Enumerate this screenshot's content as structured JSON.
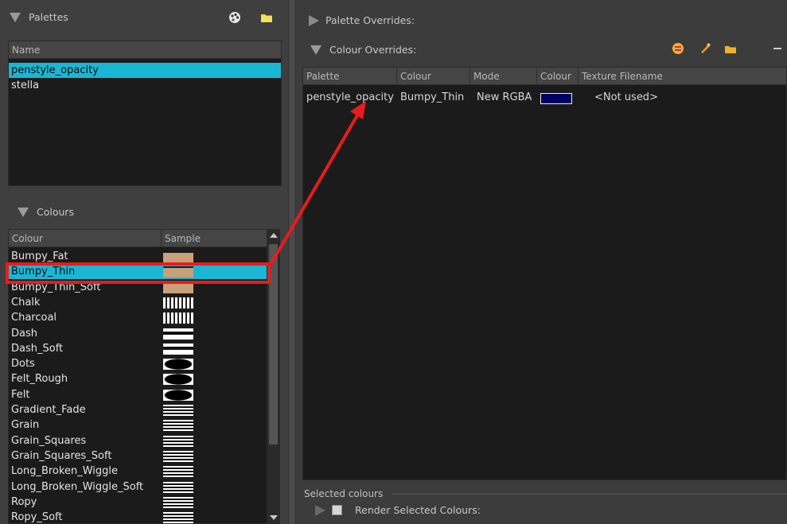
{
  "palettes_panel": {
    "title": "Palettes",
    "column_name": "Name",
    "items": [
      "penstyle_opacity",
      "stella"
    ],
    "selected_index": 0
  },
  "colours_panel": {
    "title": "Colours",
    "columns": [
      "Colour",
      "Sample"
    ],
    "items": [
      "Bumpy_Fat",
      "Bumpy_Thin",
      "Bumpy_Thin_Soft",
      "Chalk",
      "Charcoal",
      "Dash",
      "Dash_Soft",
      "Dots",
      "Felt_Rough",
      "Felt",
      "Gradient_Fade",
      "Grain",
      "Grain_Squares",
      "Grain_Squares_Soft",
      "Long_Broken_Wiggle",
      "Long_Broken_Wiggle_Soft",
      "Ropy",
      "Ropy_Soft"
    ],
    "selected_index": 1
  },
  "palette_overrides": {
    "title": "Palette Overrides:"
  },
  "colour_overrides": {
    "title": "Colour Overrides:",
    "columns": [
      "Palette",
      "Colour",
      "Mode",
      "Colour",
      "Texture Filename"
    ],
    "rows": [
      {
        "palette": "penstyle_opacity",
        "colour": "Bumpy_Thin",
        "mode": "New RGBA",
        "swatch": "#000066",
        "texture": "<Not used>"
      }
    ]
  },
  "selected_colours": {
    "group_label": "Selected colours",
    "render_label": "Render Selected Colours:"
  },
  "accent": {
    "selection": "#1ab7d4",
    "highlight": "#e81c1c"
  }
}
